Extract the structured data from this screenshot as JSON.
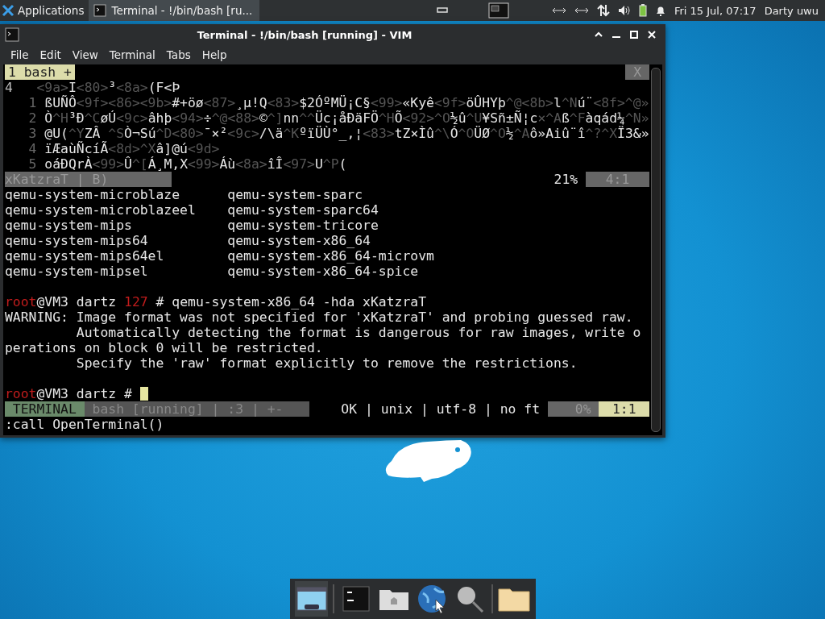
{
  "panel": {
    "apps_label": "Applications",
    "task": {
      "title": "Terminal - !/bin/bash [ru...",
      "selected": true
    },
    "clock": "Fri 15 Jul, 07:17",
    "user": "Darty uwu"
  },
  "window": {
    "title": "Terminal - !/bin/bash [running] - VIM",
    "menu": [
      "File",
      "Edit",
      "View",
      "Terminal",
      "Tabs",
      "Help"
    ]
  },
  "vim": {
    "tab": {
      "label": "1 bash +",
      "selected": true
    },
    "close_label": "X",
    "lines": [
      {
        "number": "4",
        "current": true,
        "segments": [
          {
            "kind": "control",
            "text": "<9a>"
          },
          {
            "kind": "text",
            "text": "I"
          },
          {
            "kind": "control",
            "text": "<80>"
          },
          {
            "kind": "text",
            "text": "³"
          },
          {
            "kind": "control",
            "text": "<8a>"
          },
          {
            "kind": "text",
            "text": "(F<Þ"
          }
        ]
      },
      {
        "number": "1",
        "current": false,
        "segments": [
          {
            "kind": "text",
            "text": "ßUÑÔ"
          },
          {
            "kind": "control",
            "text": "<9f><86><9b>"
          },
          {
            "kind": "text",
            "text": "#+öø"
          },
          {
            "kind": "control",
            "text": "<87>"
          },
          {
            "kind": "text",
            "text": "¸µ!Q"
          },
          {
            "kind": "control",
            "text": "<83>"
          },
          {
            "kind": "text",
            "text": "$2ÓºMÜ¡C§"
          },
          {
            "kind": "control",
            "text": "<99>"
          },
          {
            "kind": "text",
            "text": "«Kyê"
          },
          {
            "kind": "control",
            "text": "<9f>"
          },
          {
            "kind": "text",
            "text": "öÛHYþ"
          },
          {
            "kind": "control",
            "text": "^@<8b>"
          },
          {
            "kind": "text",
            "text": "l"
          },
          {
            "kind": "control",
            "text": "^N"
          },
          {
            "kind": "text",
            "text": "ú¨"
          },
          {
            "kind": "control",
            "text": "<8f>^@»"
          }
        ]
      },
      {
        "number": "2",
        "current": false,
        "segments": [
          {
            "kind": "text",
            "text": "Ò"
          },
          {
            "kind": "control",
            "text": "^H"
          },
          {
            "kind": "text",
            "text": "³Ð"
          },
          {
            "kind": "control",
            "text": "^C"
          },
          {
            "kind": "text",
            "text": "øÚ"
          },
          {
            "kind": "control",
            "text": "<9c>"
          },
          {
            "kind": "text",
            "text": "âhþ"
          },
          {
            "kind": "control",
            "text": "<94>"
          },
          {
            "kind": "text",
            "text": "÷"
          },
          {
            "kind": "control",
            "text": "^@<88>"
          },
          {
            "kind": "text",
            "text": "©"
          },
          {
            "kind": "control",
            "text": "^]"
          },
          {
            "kind": "text",
            "text": "nn"
          },
          {
            "kind": "control",
            "text": "^^"
          },
          {
            "kind": "text",
            "text": "Üc¡åÐäFÖ"
          },
          {
            "kind": "control",
            "text": "^H"
          },
          {
            "kind": "text",
            "text": "Õ"
          },
          {
            "kind": "control",
            "text": "<92>^O"
          },
          {
            "kind": "text",
            "text": "½û"
          },
          {
            "kind": "control",
            "text": "^U"
          },
          {
            "kind": "text",
            "text": "¥Sñ±Ñ¦c"
          },
          {
            "kind": "control",
            "text": "×^A"
          },
          {
            "kind": "text",
            "text": "ß"
          },
          {
            "kind": "control",
            "text": "^F"
          },
          {
            "kind": "text",
            "text": "àqád¼"
          },
          {
            "kind": "control",
            "text": "^N»"
          }
        ]
      },
      {
        "number": "3",
        "current": false,
        "segments": [
          {
            "kind": "text",
            "text": "@U("
          },
          {
            "kind": "control",
            "text": "^Y"
          },
          {
            "kind": "text",
            "text": "ZÂ "
          },
          {
            "kind": "control",
            "text": "^S"
          },
          {
            "kind": "text",
            "text": "Ò¬Sú"
          },
          {
            "kind": "control",
            "text": "^D<80>"
          },
          {
            "kind": "text",
            "text": "¯×²"
          },
          {
            "kind": "control",
            "text": "<9c>"
          },
          {
            "kind": "text",
            "text": "/\\ä"
          },
          {
            "kind": "control",
            "text": "^K"
          },
          {
            "kind": "text",
            "text": "ºïÜÙ°_,¦"
          },
          {
            "kind": "control",
            "text": "<83>"
          },
          {
            "kind": "text",
            "text": "tZ×Ìû"
          },
          {
            "kind": "control",
            "text": "^\\"
          },
          {
            "kind": "text",
            "text": "Ó"
          },
          {
            "kind": "control",
            "text": "^O"
          },
          {
            "kind": "text",
            "text": "ÜØ"
          },
          {
            "kind": "control",
            "text": "^O"
          },
          {
            "kind": "text",
            "text": "½"
          },
          {
            "kind": "control",
            "text": "^A"
          },
          {
            "kind": "text",
            "text": "ô»Aiû¨î"
          },
          {
            "kind": "control",
            "text": "^?^X"
          },
          {
            "kind": "text",
            "text": "Ï3&»"
          }
        ]
      },
      {
        "number": "4",
        "current": false,
        "segments": [
          {
            "kind": "text",
            "text": "ïÆaùÑcíÃ"
          },
          {
            "kind": "control",
            "text": "<8d>^X"
          },
          {
            "kind": "text",
            "text": "â]@ú"
          },
          {
            "kind": "control",
            "text": "<9d>"
          }
        ]
      },
      {
        "number": "5",
        "current": false,
        "segments": [
          {
            "kind": "text",
            "text": "oáÐQrÀ"
          },
          {
            "kind": "control",
            "text": "<99>"
          },
          {
            "kind": "text",
            "text": "Û"
          },
          {
            "kind": "control",
            "text": "^["
          },
          {
            "kind": "text",
            "text": "Á¸M,X"
          },
          {
            "kind": "control",
            "text": "<99>"
          },
          {
            "kind": "text",
            "text": "Áù"
          },
          {
            "kind": "control",
            "text": "<8a>"
          },
          {
            "kind": "text",
            "text": "îÎ"
          },
          {
            "kind": "control",
            "text": "<97>"
          },
          {
            "kind": "text",
            "text": "U"
          },
          {
            "kind": "control",
            "text": "^P"
          },
          {
            "kind": "text",
            "text": "("
          }
        ]
      }
    ],
    "status": {
      "file": "xKatzraT | B)",
      "percent": "21%",
      "position": "4:1"
    }
  },
  "terminal": {
    "lines": [
      {
        "kind": "text",
        "text": "qemu-system-microblaze      qemu-system-sparc"
      },
      {
        "kind": "text",
        "text": "qemu-system-microblazeel    qemu-system-sparc64"
      },
      {
        "kind": "text",
        "text": "qemu-system-mips            qemu-system-tricore"
      },
      {
        "kind": "text",
        "text": "qemu-system-mips64          qemu-system-x86_64"
      },
      {
        "kind": "text",
        "text": "qemu-system-mips64el        qemu-system-x86_64-microvm"
      },
      {
        "kind": "text",
        "text": "qemu-system-mipsel          qemu-system-x86_64-spice"
      },
      {
        "kind": "blank"
      },
      {
        "kind": "prompt",
        "user": "root",
        "host": "@VM3 dartz",
        "code": "127",
        "symbol": "#",
        "command": "qemu-system-x86_64 -hda xKatzraT",
        "cursor": false
      },
      {
        "kind": "text",
        "text": "WARNING: Image format was not specified for 'xKatzraT' and probing guessed raw."
      },
      {
        "kind": "text",
        "text": "         Automatically detecting the format is dangerous for raw images, write o"
      },
      {
        "kind": "text",
        "text": "perations on block 0 will be restricted."
      },
      {
        "kind": "text",
        "text": "         Specify the 'raw' format explicitly to remove the restrictions."
      },
      {
        "kind": "blank"
      },
      {
        "kind": "prompt",
        "user": "root",
        "host": "@VM3 dartz",
        "symbol": "#",
        "cursor": true
      }
    ]
  },
  "statusline": {
    "mode": "TERMINAL",
    "buffer": "bash [running] | :3 | +-",
    "info": "OK | unix | utf-8 | no ft",
    "percent": "0%",
    "position": "1:1"
  },
  "command_line": ":call OpenTerminal()"
}
